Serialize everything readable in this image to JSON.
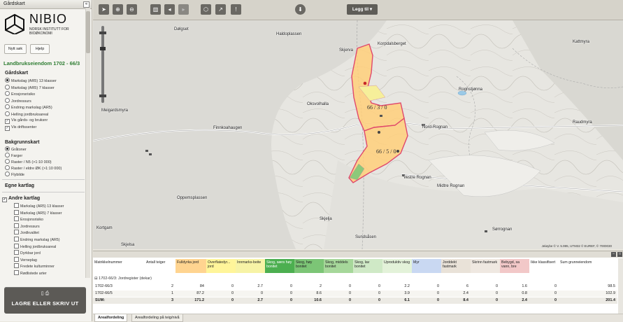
{
  "panel": {
    "title": "Gårdskart",
    "collapse": "«"
  },
  "logo": {
    "name": "NIBIO",
    "subtitle_line1": "NORSK INSTITUTT FOR",
    "subtitle_line2": "BIOØKONOMI"
  },
  "buttons": {
    "new_search": "Nytt søk",
    "help": "Hjelp"
  },
  "property": {
    "title": "Landbrukseiendom 1702 - 66/3"
  },
  "gardskart": {
    "heading": "Gårdskart",
    "options": [
      {
        "label": "Markslag (AR5) 13 klasser",
        "type": "radio",
        "selected": true
      },
      {
        "label": "Markslag (AR5) 7 klasser",
        "type": "radio",
        "selected": false
      },
      {
        "label": "Erosjonsrisiko",
        "type": "radio",
        "selected": false
      },
      {
        "label": "Jordressurs",
        "type": "radio",
        "selected": false
      },
      {
        "label": "Endring markslag (AR5)",
        "type": "radio",
        "selected": false
      },
      {
        "label": "Helling jordbruksareal",
        "type": "radio",
        "selected": false
      },
      {
        "label": "Vis gårds- og bruksnr",
        "type": "check",
        "selected": true
      },
      {
        "label": "Vis driftssenter",
        "type": "check",
        "selected": true
      }
    ]
  },
  "bakgrunn": {
    "heading": "Bakgrunnskart",
    "options": [
      {
        "label": "Gråtoner",
        "selected": true
      },
      {
        "label": "Farger",
        "selected": false
      },
      {
        "label": "Raster / N5 (>1:10 000)",
        "selected": false
      },
      {
        "label": "Raster / eldre ØK (>1:10 000)",
        "selected": false
      },
      {
        "label": "Flybilde",
        "selected": false
      }
    ]
  },
  "egne": {
    "heading": "Egne kartlag"
  },
  "andre": {
    "heading": "Andre kartlag",
    "items": [
      "Markslag (AR5) 13 klasser",
      "Markslag (AR5) 7 klasser",
      "Erosjonsrisiko",
      "Jordressurs",
      "Jordkvalitet",
      "Endring markslag (AR5)",
      "Helling jordbruksareal",
      "Dyrkbar jord",
      "Verneplag",
      "Fredete kulturminner",
      "Rødlistede arter"
    ]
  },
  "save": {
    "label": "LAGRE ELLER SKRIV UT",
    "icons": "▯  ⎙"
  },
  "toolbar": {
    "legg_til": "Legg til ▾"
  },
  "map": {
    "labels": [
      {
        "text": "Dølgset"
      },
      {
        "text": "Haldoplassen"
      },
      {
        "text": "Korpdalsberget"
      },
      {
        "text": "Kattmyra"
      },
      {
        "text": "Rognstjønna"
      },
      {
        "text": "Meigardsmyra"
      },
      {
        "text": "Oksvolhalla"
      },
      {
        "text": "Finnkoahaugen"
      },
      {
        "text": "Nord-Rognan"
      },
      {
        "text": "Raudmyra"
      },
      {
        "text": "Vestre Rognan"
      },
      {
        "text": "Midtre Rognan"
      },
      {
        "text": "Oppemsplassen"
      },
      {
        "text": "Skjelja"
      },
      {
        "text": "Sundsåsen"
      },
      {
        "text": "Sørrognan"
      },
      {
        "text": "Skjelsa"
      },
      {
        "text": "Skjerva"
      },
      {
        "text": "Skjelja"
      },
      {
        "text": "Kortgam"
      }
    ],
    "parcels": [
      "66 / 3 / 0",
      "66 / 5 / 0"
    ],
    "copyright": "Jeløybe © V. 5.995, UTM32 © EUREF, © 7000030"
  },
  "table": {
    "headers": [
      "Matrikkelnummer",
      "Antall teiger",
      "Fulldyrka jord",
      "Overflatedyr... jord",
      "Innmarks-beite",
      "Skog, særs høy bonitet",
      "Skog, høy bonitet",
      "Skog, middels bonitet",
      "Skog, lav bonitet",
      "Uproduktiv skog",
      "Myr",
      "Jorddekt fastmark",
      "Skrinn fastmark",
      "Bebygd, sa vann, bre",
      "Ikke klassifisert",
      "Sum grunneiendom"
    ],
    "header_colors": [
      "#ffffff",
      "#ffffff",
      "#ffd490",
      "#fff59a",
      "#f7f3a6",
      "#4caf50",
      "#7cc576",
      "#a6d79a",
      "#cfe9c6",
      "#e3f2d9",
      "#c9d8f2",
      "#e9e2d8",
      "#efe8e1",
      "#f2c8c8",
      "#ffffff",
      "#ffffff"
    ],
    "group_title": "1702-66/3: Jordregister (dekar)",
    "rows": [
      [
        "1702-66/3",
        "2",
        "84",
        "0",
        "2.7",
        "0",
        "2",
        "0",
        "0",
        "2.2",
        "0",
        "6",
        "0",
        "1.6",
        "0",
        "98.5"
      ],
      [
        "1702-66/5",
        "1",
        "87.2",
        "0",
        "0",
        "0",
        "8.6",
        "0",
        "0",
        "3.9",
        "0",
        "2.4",
        "0",
        "0.8",
        "0",
        "102.9"
      ],
      [
        "SUM:",
        "3",
        "171.2",
        "0",
        "2.7",
        "0",
        "10.6",
        "0",
        "0",
        "6.1",
        "0",
        "8.4",
        "0",
        "2.4",
        "0",
        "201.4"
      ]
    ],
    "tabs": [
      "Arealfordeling",
      "Arealfordeling på teig/nivå"
    ]
  }
}
